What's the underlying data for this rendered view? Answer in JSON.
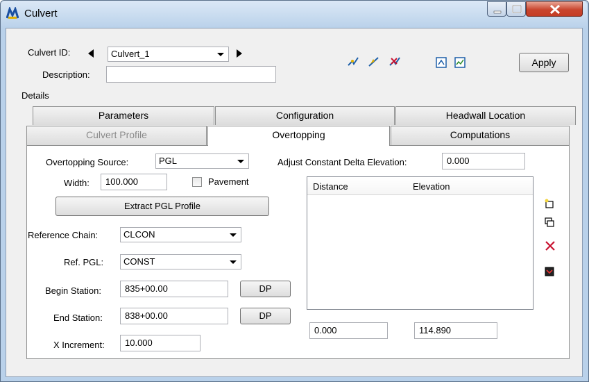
{
  "window": {
    "title": "Culvert"
  },
  "header": {
    "culvert_id_label": "Culvert ID:",
    "culvert_id_value": "Culvert_1",
    "description_label": "Description:",
    "description_value": "",
    "apply_label": "Apply"
  },
  "details": {
    "group_label": "Details"
  },
  "tabs_row1": [
    {
      "label": "Parameters"
    },
    {
      "label": "Configuration"
    },
    {
      "label": "Headwall Location"
    }
  ],
  "tabs_row2": [
    {
      "label": "Culvert Profile",
      "state": "disabled"
    },
    {
      "label": "Overtopping",
      "state": "active"
    },
    {
      "label": "Computations",
      "state": "normal"
    }
  ],
  "overtopping": {
    "source_label": "Overtopping Source:",
    "source_value": "PGL",
    "adjust_label": "Adjust Constant Delta Elevation:",
    "adjust_value": "0.000",
    "width_label": "Width:",
    "width_value": "100.000",
    "pavement_label": "Pavement",
    "pavement_checked": false,
    "extract_label": "Extract PGL Profile",
    "ref_chain_label": "Reference Chain:",
    "ref_chain_value": "CLCON",
    "ref_pgl_label": "Ref. PGL:",
    "ref_pgl_value": "CONST",
    "begin_label": "Begin Station:",
    "begin_value": "835+00.00",
    "end_label": "End Station:",
    "end_value": "838+00.00",
    "dp_label": "DP",
    "xinc_label": "X Increment:",
    "xinc_value": "10.000",
    "table": {
      "columns": [
        "Distance",
        "Elevation"
      ],
      "rows": []
    },
    "distance_input": "0.000",
    "elevation_input": "114.890"
  },
  "icons": {
    "toolbar": [
      "locate-icon",
      "edit-icon",
      "delete-icon",
      "view-icon",
      "export-icon"
    ],
    "side": [
      "add-row-icon",
      "copy-row-icon",
      "delete-row-icon",
      "chart-icon"
    ]
  },
  "colors": {
    "accent_red": "#c8102e",
    "title_bar": "#b9d1ea",
    "close_button": "#c9462f"
  }
}
